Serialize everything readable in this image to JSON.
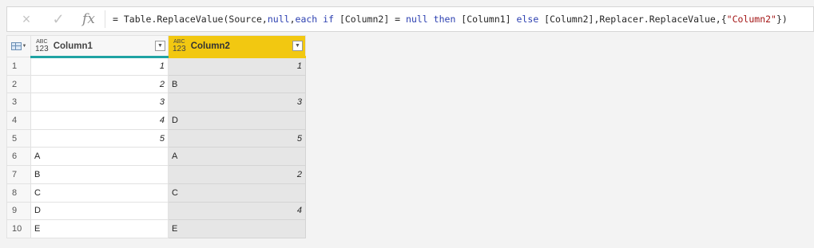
{
  "formula_bar": {
    "cancel_icon": "×",
    "check_icon": "✓",
    "fx_icon": "fx",
    "formula_parts": [
      "= Table.ReplaceValue(Source,",
      "null",
      ",",
      "each",
      " ",
      "if",
      " [Column2] = ",
      "null",
      " ",
      "then",
      " [Column1] ",
      "else",
      " [Column2],Replacer.ReplaceValue,{",
      "\"Column2\"",
      "})"
    ]
  },
  "table": {
    "columns": [
      {
        "type_top": "ABC",
        "type_bottom": "123",
        "name": "Column1"
      },
      {
        "type_top": "ABC",
        "type_bottom": "123",
        "name": "Column2"
      }
    ],
    "rows": [
      {
        "index": "1",
        "col1": "1",
        "col2": "1"
      },
      {
        "index": "2",
        "col1": "2",
        "col2": "B"
      },
      {
        "index": "3",
        "col1": "3",
        "col2": "3"
      },
      {
        "index": "4",
        "col1": "4",
        "col2": "D"
      },
      {
        "index": "5",
        "col1": "5",
        "col2": "5"
      },
      {
        "index": "6",
        "col1": "A",
        "col2": "A"
      },
      {
        "index": "7",
        "col1": "B",
        "col2": "2"
      },
      {
        "index": "8",
        "col1": "C",
        "col2": "C"
      },
      {
        "index": "9",
        "col1": "D",
        "col2": "4"
      },
      {
        "index": "10",
        "col1": "E",
        "col2": "E"
      }
    ]
  },
  "colors": {
    "column1_header_accent": "#1fa3a3",
    "column2_header_selected": "#f2c811",
    "selected_column_fill": "#e6e6e6"
  }
}
